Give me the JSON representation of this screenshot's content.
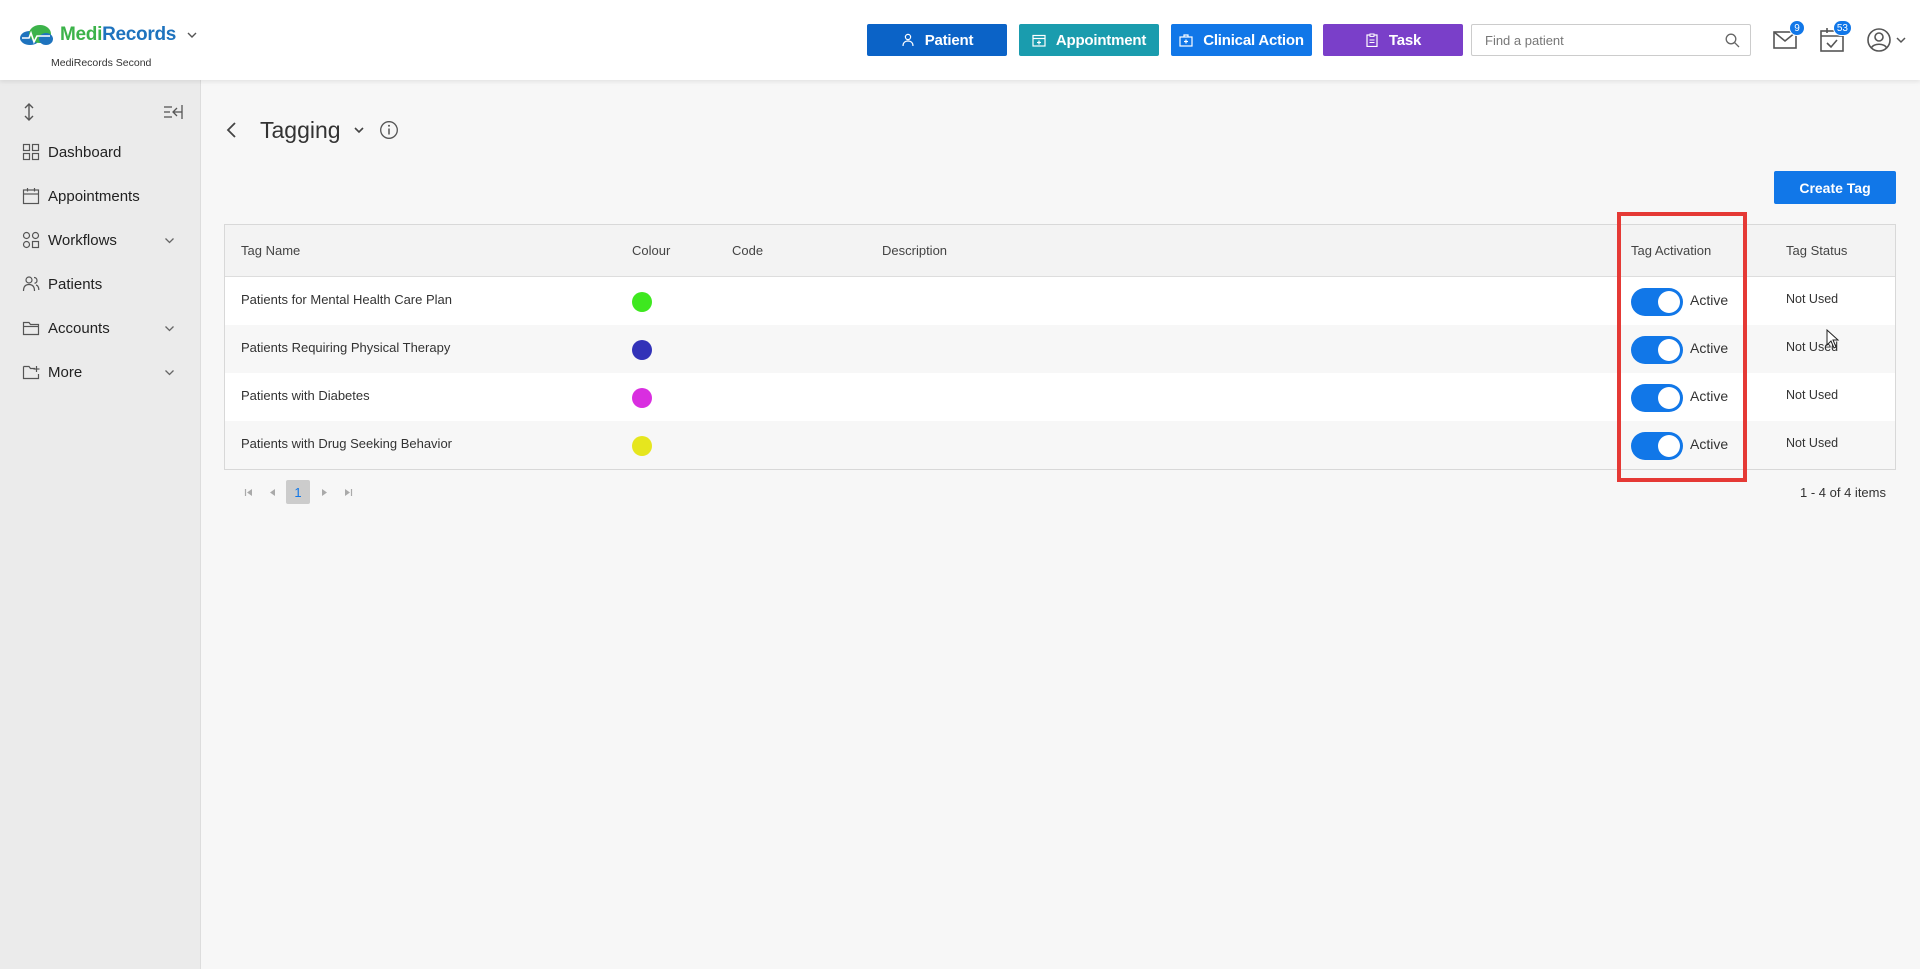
{
  "app": {
    "brand_part1": "Medi",
    "brand_part2": "Records",
    "practice": "MediRecords Second"
  },
  "header": {
    "buttons": [
      {
        "label": "Patient",
        "icon": "add-person-icon",
        "color": "#0b63c7"
      },
      {
        "label": "Appointment",
        "icon": "calendar-plus-icon",
        "color": "#1a9cae"
      },
      {
        "label": "Clinical Action",
        "icon": "medical-bag-icon",
        "color": "#1177e8"
      },
      {
        "label": "Task",
        "icon": "clipboard-icon",
        "color": "#7a3fc9"
      }
    ],
    "search_placeholder": "Find a patient",
    "mail_badge": "9",
    "tasks_badge": "53"
  },
  "sidebar": {
    "items": [
      {
        "label": "Dashboard",
        "icon": "dashboard-icon"
      },
      {
        "label": "Appointments",
        "icon": "calendar-icon"
      },
      {
        "label": "Workflows",
        "icon": "workflow-icon",
        "has_submenu": true
      },
      {
        "label": "Patients",
        "icon": "users-icon"
      },
      {
        "label": "Accounts",
        "icon": "folder-icon",
        "has_submenu": true
      },
      {
        "label": "More",
        "icon": "folder-plus-icon",
        "has_submenu": true
      }
    ]
  },
  "page": {
    "title": "Tagging",
    "create_button": "Create Tag"
  },
  "table": {
    "columns": [
      "Tag Name",
      "Colour",
      "Code",
      "Description",
      "Tag Activation",
      "Tag Status"
    ],
    "rows": [
      {
        "name": "Patients for Mental Health Care Plan",
        "colour": "#3ee81f",
        "code": "",
        "description": "",
        "activation": "Active",
        "active": true,
        "status": "Not Used"
      },
      {
        "name": "Patients Requiring Physical Therapy",
        "colour": "#3232b8",
        "code": "",
        "description": "",
        "activation": "Active",
        "active": true,
        "status": "Not Used"
      },
      {
        "name": "Patients with Diabetes",
        "colour": "#d92ee0",
        "code": "",
        "description": "",
        "activation": "Active",
        "active": true,
        "status": "Not Used"
      },
      {
        "name": "Patients with Drug Seeking Behavior",
        "colour": "#e6e61e",
        "code": "",
        "description": "",
        "activation": "Active",
        "active": true,
        "status": "Not Used"
      }
    ]
  },
  "pager": {
    "current_page": "1",
    "info": "1 - 4 of 4 items"
  },
  "colors": {
    "primary": "#1177e8",
    "highlight": "#e53935"
  }
}
